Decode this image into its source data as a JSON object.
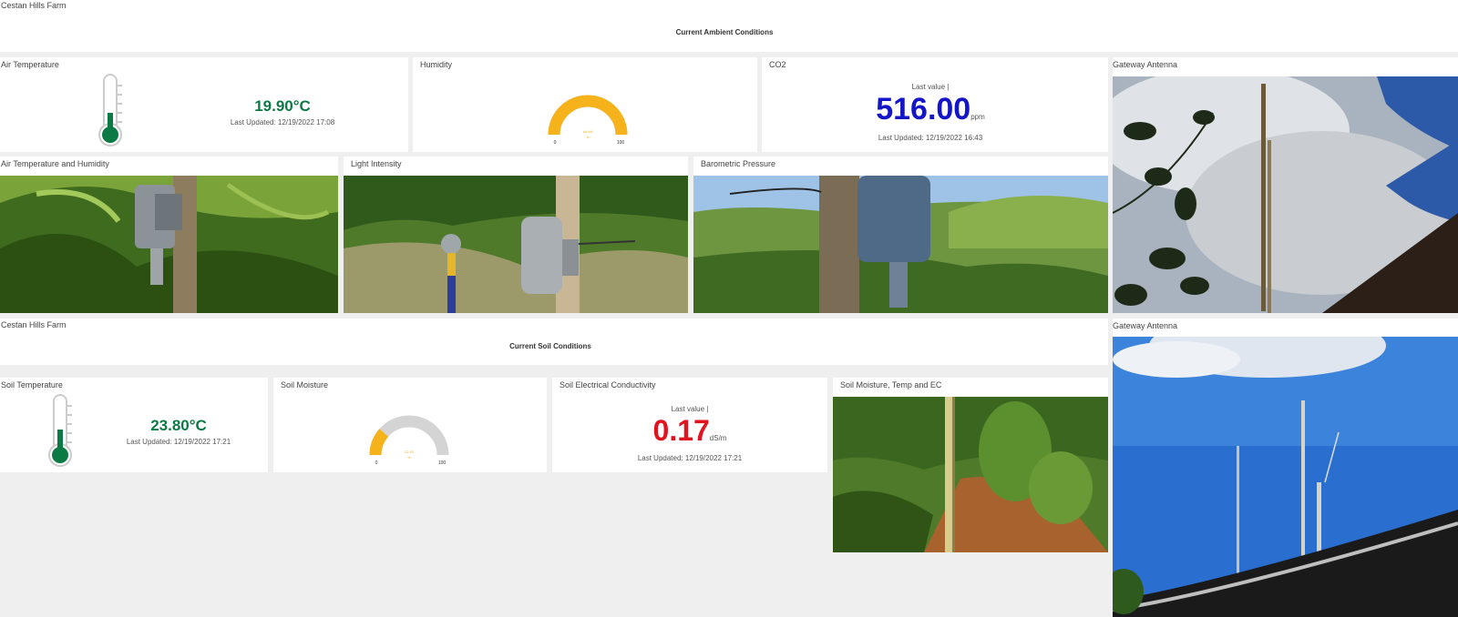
{
  "farm_title": "Cestan Hills Farm",
  "ambient": {
    "heading": "Current Ambient Conditions",
    "air_temp": {
      "title": "Air Temperature",
      "value": "19.90°C",
      "updated": "Last Updated: 12/19/2022 17:08"
    },
    "humidity": {
      "title": "Humidity",
      "min": "0",
      "max": "100",
      "value_label": "##.##",
      "unit": "%",
      "fill_fraction": 1.0
    },
    "co2": {
      "title": "CO2",
      "caption": "Last value |",
      "value": "516.00",
      "unit": "ppm",
      "updated": "Last Updated: 12/19/2022 16:43"
    },
    "images": {
      "air_temp_humidity": "Air Temperature and Humidity",
      "light": "Light Intensity",
      "pressure": "Barometric Pressure"
    }
  },
  "gateway": {
    "title_1": "Gateway Antenna",
    "title_2": "Gateway Antenna"
  },
  "soil": {
    "farm_title": "Cestan Hills Farm",
    "heading": "Current Soil Conditions",
    "temp": {
      "title": "Soil Temperature",
      "value": "23.80°C",
      "updated": "Last Updated: 12/19/2022 17:21"
    },
    "moisture": {
      "title": "Soil Moisture",
      "min": "0",
      "max": "100",
      "value_label": "22.93",
      "unit": "%",
      "fill_fraction": 0.23
    },
    "ec": {
      "title": "Soil Electrical Conductivity",
      "caption": "Last value |",
      "value": "0.17",
      "unit": "dS/m",
      "updated": "Last Updated: 12/19/2022 17:21"
    },
    "image_title": "Soil Moisture, Temp and EC"
  },
  "colors": {
    "green": "#0b7a45",
    "blue": "#1515c8",
    "red": "#e0141e",
    "gauge": "#f5b21a"
  },
  "icons": [
    "thermometer-icon",
    "gauge-icon"
  ]
}
